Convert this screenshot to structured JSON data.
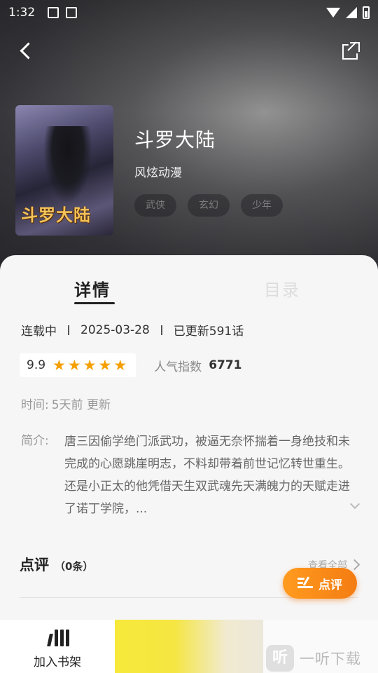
{
  "status_bar": {
    "time": "1:32",
    "icons": [
      "image-icon",
      "a-icon",
      "wifi-icon",
      "signal-icon",
      "battery-icon"
    ]
  },
  "header": {
    "back_icon": "back-arrow-icon",
    "share_icon": "share-icon"
  },
  "book": {
    "cover_text": "斗罗大陆",
    "title": "斗罗大陆",
    "author": "风炫动漫",
    "tags": [
      "武侠",
      "玄幻",
      "少年"
    ]
  },
  "tabs": {
    "detail": "详情",
    "toc": "目录"
  },
  "info": {
    "status": "连载中",
    "date": "2025-03-28",
    "updated": "已更新591话",
    "score": "9.9",
    "stars": 5,
    "popularity_label": "人气指数",
    "popularity_value": "6771",
    "time_label": "时间:",
    "time_value": "5天前 更新",
    "intro_label": "简介:",
    "intro_text": "唐三因偷学绝门派武功，被逼无奈怀揣着一身绝技和未完成的心愿跳崖明志，不料却带着前世记忆转世重生。还是小正太的他凭借天生双武魂先天满魄力的天赋走进了诺丁学院，..."
  },
  "reviews": {
    "title": "点评",
    "count": "（0条）",
    "view_all": "查看全部",
    "fab_label": "点评"
  },
  "bottom_bar": {
    "shelf_label": "加入书架"
  },
  "watermark": {
    "badge": "听",
    "text": "一听下载"
  },
  "colors": {
    "accent": "#f7901a",
    "star": "#f5a000",
    "read_button": "#f5e642"
  }
}
